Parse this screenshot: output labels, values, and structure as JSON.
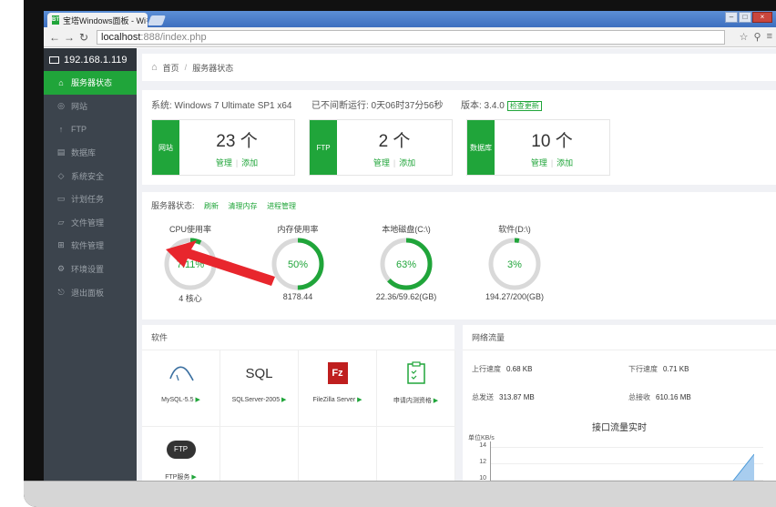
{
  "browser": {
    "tab_title": "宝塔Windows面板 - Wi",
    "favicon": "BT",
    "url_host": "localhost",
    "url_rest": ":888/index.php"
  },
  "sidebar": {
    "host": "192.168.1.119",
    "items": [
      {
        "label": "服务器状态",
        "icon": "home-icon",
        "active": true
      },
      {
        "label": "网站",
        "icon": "globe-icon"
      },
      {
        "label": "FTP",
        "icon": "ftp-icon"
      },
      {
        "label": "数据库",
        "icon": "database-icon"
      },
      {
        "label": "系统安全",
        "icon": "shield-icon"
      },
      {
        "label": "计划任务",
        "icon": "calendar-icon"
      },
      {
        "label": "文件管理",
        "icon": "folder-icon"
      },
      {
        "label": "软件管理",
        "icon": "grid-icon"
      },
      {
        "label": "环境设置",
        "icon": "gear-icon"
      },
      {
        "label": "退出面板",
        "icon": "logout-icon"
      }
    ]
  },
  "breadcrumb": {
    "home": "首页",
    "current": "服务器状态"
  },
  "system": {
    "os": "系统: Windows 7 Ultimate SP1 x64",
    "uptime": "已不间断运行: 0天06时37分56秒",
    "version": "版本: 3.4.0",
    "update": "检查更新"
  },
  "cards": [
    {
      "tag": "网站",
      "count": "23 个",
      "manage": "管理",
      "add": "添加"
    },
    {
      "tag": "FTP",
      "count": "2 个",
      "manage": "管理",
      "add": "添加"
    },
    {
      "tag": "数据库",
      "count": "10 个",
      "manage": "管理",
      "add": "添加"
    }
  ],
  "status": {
    "title": "服务器状态:",
    "links": [
      "刷新",
      "清理内存",
      "进程管理"
    ],
    "gauges": [
      {
        "label": "CPU使用率",
        "value": "7.11%",
        "percent": 7.11,
        "sub": "4 核心"
      },
      {
        "label": "内存使用率",
        "value": "50%",
        "percent": 50,
        "sub": "8178.44"
      },
      {
        "label": "本地磁盘(C:\\)",
        "value": "63%",
        "percent": 63,
        "sub": "22.36/59.62(GB)"
      },
      {
        "label": "软件(D:\\)",
        "value": "3%",
        "percent": 3,
        "sub": "194.27/200(GB)"
      }
    ]
  },
  "software": {
    "title": "软件",
    "items": [
      {
        "label": "MySQL-5.5",
        "icon": "mysql-icon"
      },
      {
        "label": "SQLServer-2005",
        "icon": "sql-icon",
        "icon_text": "SQL"
      },
      {
        "label": "FileZilla Server",
        "icon": "filezilla-icon",
        "icon_text": "Fz"
      },
      {
        "label": "申请内测资格",
        "icon": "checklist-icon"
      },
      {
        "label": "FTP服务",
        "icon": "ftp-cloud-icon",
        "icon_text": "FTP"
      }
    ]
  },
  "network": {
    "title": "网络流量",
    "up_label": "上行速度",
    "up_value": "0.68 KB",
    "down_label": "下行速度",
    "down_value": "0.71 KB",
    "sent_label": "总发送",
    "sent_value": "313.87 MB",
    "recv_label": "总接收",
    "recv_value": "610.16 MB",
    "chart_title": "接口流量实时",
    "unit": "单位KB/s",
    "ticks": [
      "14",
      "12",
      "10"
    ]
  },
  "colors": {
    "accent": "#20a53a",
    "sidebar": "#3c444d",
    "arrow": "#e8262d"
  }
}
